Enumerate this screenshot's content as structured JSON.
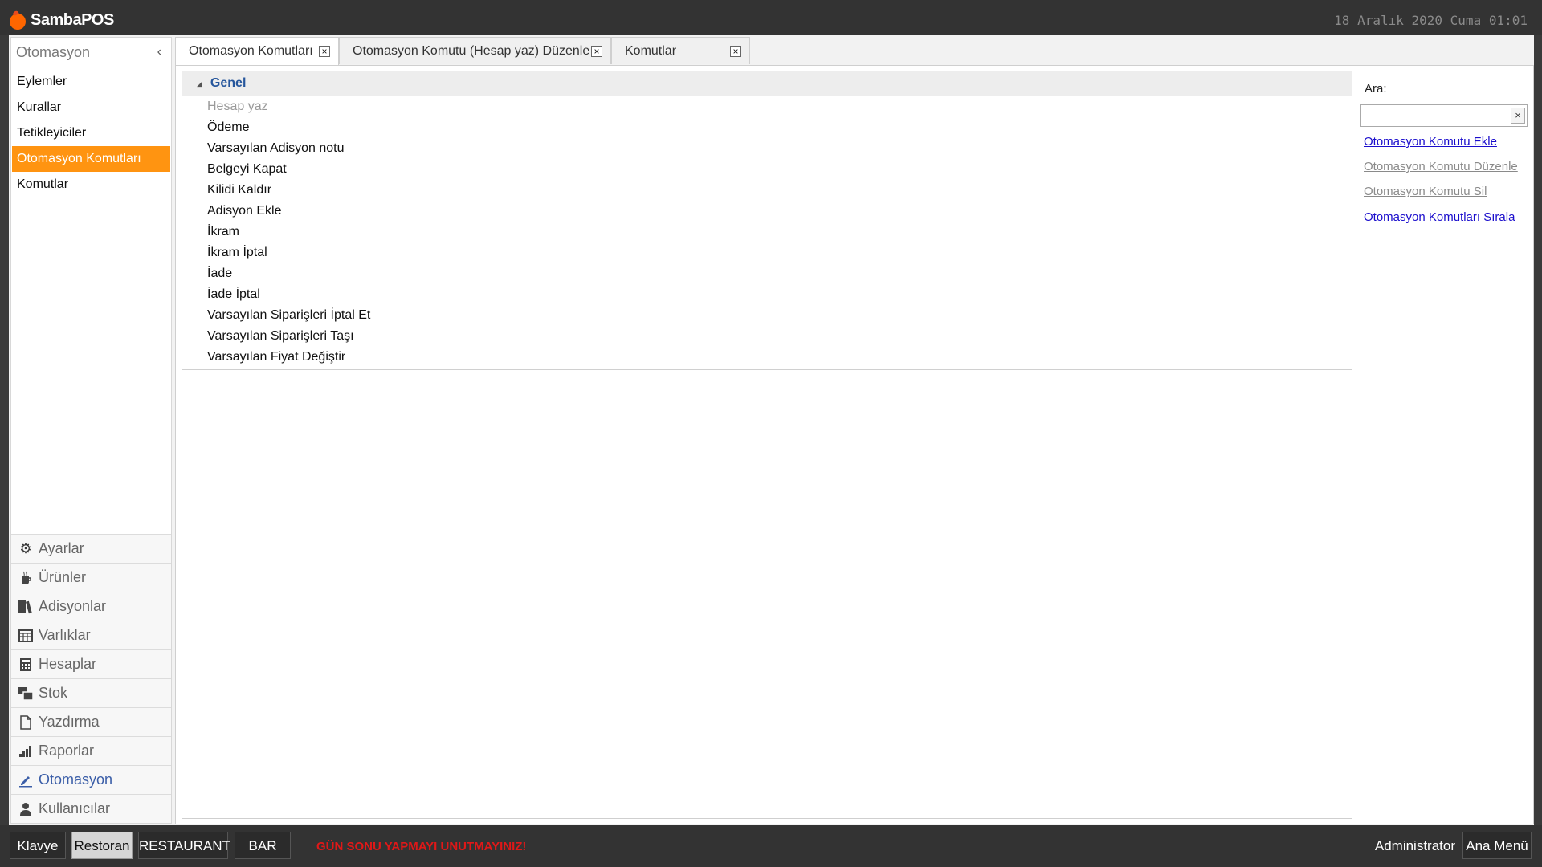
{
  "app": {
    "name": "SambaPOS",
    "datetime": "18 Aralık 2020 Cuma 01:01"
  },
  "sidebar": {
    "header": "Otomasyon",
    "items": [
      {
        "label": "Eylemler",
        "active": false
      },
      {
        "label": "Kurallar",
        "active": false
      },
      {
        "label": "Tetikleyiciler",
        "active": false
      },
      {
        "label": "Otomasyon Komutları",
        "active": true
      },
      {
        "label": "Komutlar",
        "active": false
      }
    ],
    "sections": [
      {
        "label": "Ayarlar",
        "icon": "gear-icon"
      },
      {
        "label": "Ürünler",
        "icon": "coffee-cup-icon"
      },
      {
        "label": "Adisyonlar",
        "icon": "books-icon"
      },
      {
        "label": "Varlıklar",
        "icon": "table-icon"
      },
      {
        "label": "Hesaplar",
        "icon": "calculator-icon"
      },
      {
        "label": "Stok",
        "icon": "boxes-icon"
      },
      {
        "label": "Yazdırma",
        "icon": "document-icon"
      },
      {
        "label": "Raporlar",
        "icon": "bar-chart-icon"
      },
      {
        "label": "Otomasyon",
        "icon": "pencil-icon",
        "active": true
      },
      {
        "label": "Kullanıcılar",
        "icon": "user-icon"
      }
    ]
  },
  "tabs": [
    {
      "label": "Otomasyon Komutları",
      "active": true
    },
    {
      "label": "Otomasyon Komutu (Hesap yaz) Düzenle",
      "active": false
    },
    {
      "label": "Komutlar",
      "active": false
    }
  ],
  "list": {
    "group": "Genel",
    "rows": [
      {
        "label": "Hesap yaz",
        "disabled": true
      },
      {
        "label": "Ödeme"
      },
      {
        "label": "Varsayılan Adisyon notu"
      },
      {
        "label": "Belgeyi Kapat"
      },
      {
        "label": "Kilidi Kaldır"
      },
      {
        "label": "Adisyon Ekle"
      },
      {
        "label": "İkram"
      },
      {
        "label": "İkram İptal"
      },
      {
        "label": "İade"
      },
      {
        "label": "İade İptal"
      },
      {
        "label": "Varsayılan Siparişleri İptal Et"
      },
      {
        "label": "Varsayılan Siparişleri Taşı"
      },
      {
        "label": "Varsayılan Fiyat Değiştir"
      }
    ]
  },
  "side": {
    "search_label": "Ara:",
    "search_value": "",
    "actions": [
      {
        "label": "Otomasyon Komutu Ekle",
        "enabled": true
      },
      {
        "label": "Otomasyon Komutu Düzenle",
        "enabled": false
      },
      {
        "label": "Otomasyon Komutu Sil",
        "enabled": false
      },
      {
        "label": "Otomasyon Komutları Sırala",
        "enabled": true
      }
    ]
  },
  "statusbar": {
    "buttons": [
      {
        "label": "Klavye",
        "active": false
      },
      {
        "label": "Restoran",
        "active": true
      },
      {
        "label": "RESTAURANT",
        "active": false
      },
      {
        "label": "BAR",
        "active": false
      }
    ],
    "warning": "GÜN SONU YAPMAYI UNUTMAYINIZ!",
    "user": "Administrator",
    "main_menu": "Ana Menü"
  },
  "colors": {
    "accent": "#ff9411",
    "link": "#1a0dcc",
    "group_title": "#26569c",
    "warning": "#e01818"
  }
}
